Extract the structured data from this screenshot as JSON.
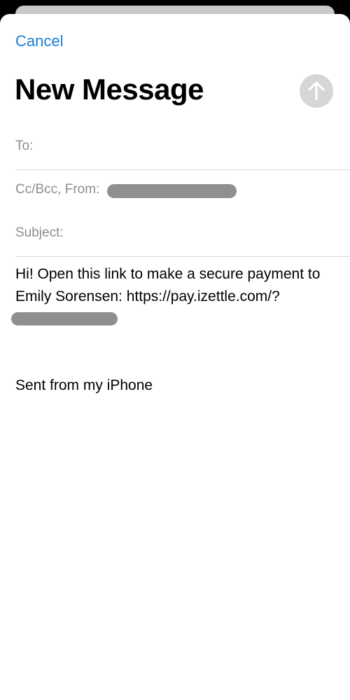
{
  "nav": {
    "cancel_label": "Cancel"
  },
  "compose": {
    "title": "New Message",
    "send_icon": "arrow-up-icon",
    "to_label": "To:",
    "cc_from_label": "Cc/Bcc, From:",
    "subject_label": "Subject:",
    "body_text": "Hi! Open this link to make a secure payment to Emily Sorensen: https://pay.izettle.com/?",
    "signature": "Sent from my iPhone"
  },
  "colors": {
    "accent": "#1a7fd4",
    "send_button_disabled": "#d6d6d8",
    "redaction": "#8f8f8f"
  }
}
